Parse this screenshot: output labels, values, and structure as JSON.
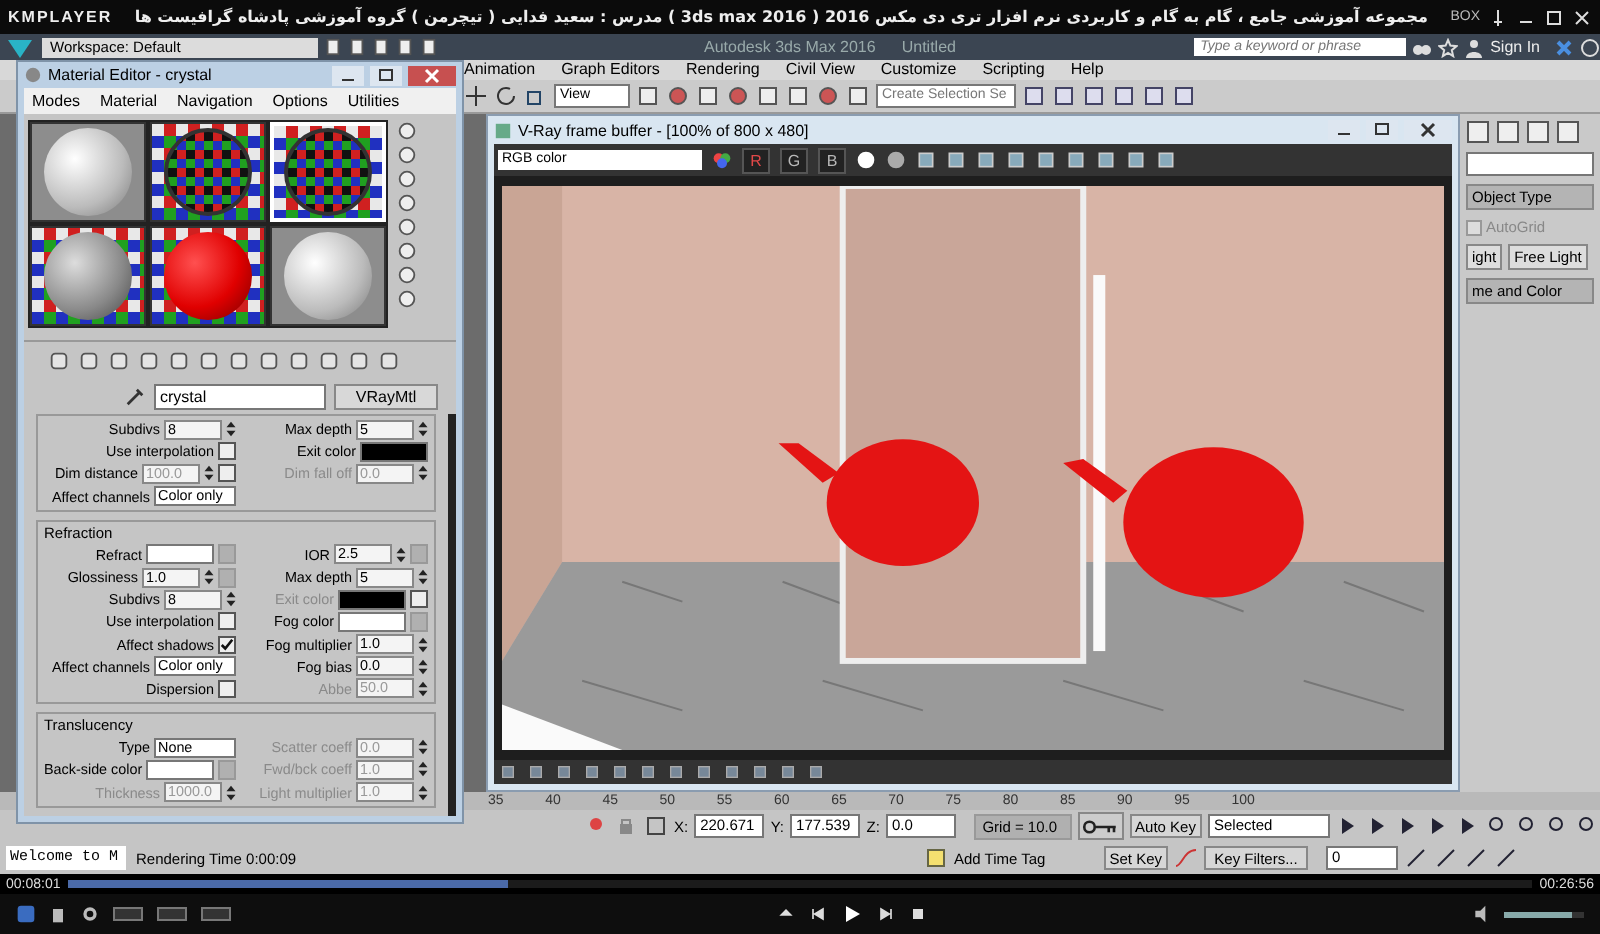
{
  "player": {
    "brand": "KMPLAYER",
    "title": "مجموعه آموزشی جامع ، گام به گام و کاربردی نرم افزار تری دی مکس 2016 ( 3ds max 2016 ) مدرس : سعید فدایی ( تیچرمن ) گروه آموزشی پادشاه گرافیست ها",
    "box": "BOX",
    "elapsed": "00:08:01",
    "total": "00:26:56",
    "progress": {
      "level": 0.3
    },
    "volume": {
      "level": 0.85
    }
  },
  "max": {
    "workspace": "Workspace: Default",
    "title": "Autodesk 3ds Max 2016",
    "file": "Untitled",
    "search": {
      "placeholder": "Type a keyword or phrase"
    },
    "sign_in": "Sign In",
    "menu": [
      "Animation",
      "Graph Editors",
      "Rendering",
      "Civil View",
      "Customize",
      "Scripting",
      "Help"
    ],
    "view": "View",
    "selection_set": "Create Selection Se",
    "command_panel": {
      "object_type": "Object Type",
      "autogrid": {
        "label": "AutoGrid",
        "checked": false,
        "disabled": true
      },
      "buttons": [
        "ight",
        "Free Light"
      ],
      "name_and_color": "me and Color"
    },
    "ruler": [
      "35",
      "40",
      "45",
      "50",
      "55",
      "60",
      "65",
      "70",
      "75",
      "80",
      "85",
      "90",
      "95",
      "100"
    ],
    "status": {
      "prompt": "Welcome to M",
      "render_time": "Rendering Time  0:00:09",
      "coords": [
        {
          "axis": "X:",
          "value": "220.671"
        },
        {
          "axis": "Y:",
          "value": "177.539"
        },
        {
          "axis": "Z:",
          "value": "0.0"
        }
      ],
      "grid": "Grid = 10.0",
      "add_time_tag": "Add Time Tag",
      "auto_key": "Auto Key",
      "key_mode": "Selected",
      "set_key": "Set Key",
      "key_filters": "Key Filters...",
      "frame": "0"
    }
  },
  "material_editor": {
    "title": "Material Editor - crystal",
    "menu": [
      "Modes",
      "Material",
      "Navigation",
      "Options",
      "Utilities"
    ],
    "slots": [
      {
        "kind": "plain",
        "selected": false
      },
      {
        "kind": "checker-ring",
        "selected": false
      },
      {
        "kind": "checker-ring",
        "selected": true
      },
      {
        "kind": "checker-gray",
        "selected": false
      },
      {
        "kind": "red",
        "selected": false
      },
      {
        "kind": "plain",
        "selected": false
      }
    ],
    "material_name": "crystal",
    "material_type": "VRayMtl",
    "sections": [
      {
        "rows": [
          {
            "left": {
              "label": "Subdivs",
              "kind": "spinner",
              "value": "8",
              "disabled": false
            },
            "right": {
              "label": "Max depth",
              "kind": "spinner",
              "value": "5",
              "disabled": false
            }
          },
          {
            "left": {
              "label": "Use interpolation",
              "kind": "checkbox",
              "checked": false,
              "disabled": false
            },
            "right": {
              "label": "Exit color",
              "kind": "color",
              "color": "#000000",
              "disabled": false
            }
          },
          {
            "left": {
              "label": "Dim distance",
              "kind": "spinner-check",
              "value": "100.0",
              "checked": false,
              "disabled": false
            },
            "right": {
              "label": "Dim fall off",
              "kind": "spinner",
              "value": "0.0",
              "disabled": true
            }
          },
          {
            "left": {
              "label": "Affect channels",
              "kind": "dropdown",
              "value": "Color only",
              "disabled": false
            }
          }
        ]
      },
      {
        "title": "Refraction",
        "rows": [
          {
            "left": {
              "label": "Refract",
              "kind": "color",
              "color": "#ffffff",
              "map": true,
              "disabled": false
            },
            "right": {
              "label": "IOR",
              "kind": "spinner",
              "value": "2.5",
              "map": true,
              "disabled": false
            }
          },
          {
            "left": {
              "label": "Glossiness",
              "kind": "spinner",
              "value": "1.0",
              "map": true,
              "disabled": false
            },
            "right": {
              "label": "Max depth",
              "kind": "spinner",
              "value": "5",
              "disabled": false
            }
          },
          {
            "left": {
              "label": "Subdivs",
              "kind": "spinner",
              "value": "8",
              "disabled": false
            },
            "right": {
              "label": "Exit color",
              "kind": "color-check",
              "color": "#000000",
              "checked": false,
              "disabled": true
            }
          },
          {
            "left": {
              "label": "Use interpolation",
              "kind": "checkbox",
              "checked": false,
              "disabled": false
            },
            "right": {
              "label": "Fog color",
              "kind": "color",
              "color": "#ffffff",
              "map": true,
              "disabled": false
            }
          },
          {
            "left": {
              "label": "Affect shadows",
              "kind": "checkbox",
              "checked": true,
              "disabled": false
            },
            "right": {
              "label": "Fog multiplier",
              "kind": "spinner",
              "value": "1.0",
              "disabled": false
            }
          },
          {
            "left": {
              "label": "Affect channels",
              "kind": "dropdown",
              "value": "Color only",
              "disabled": false
            },
            "right": {
              "label": "Fog bias",
              "kind": "spinner",
              "value": "0.0",
              "disabled": false
            }
          },
          {
            "left": {
              "label": "Dispersion",
              "kind": "checkbox",
              "checked": false,
              "disabled": false
            },
            "right": {
              "label": "Abbe",
              "kind": "spinner",
              "value": "50.0",
              "disabled": true
            }
          }
        ]
      },
      {
        "title": "Translucency",
        "rows": [
          {
            "left": {
              "label": "Type",
              "kind": "dropdown",
              "value": "None",
              "disabled": false
            },
            "right": {
              "label": "Scatter coeff",
              "kind": "spinner",
              "value": "0.0",
              "disabled": true
            }
          },
          {
            "left": {
              "label": "Back-side color",
              "kind": "color",
              "color": "#ffffff",
              "map": true,
              "disabled": false
            },
            "right": {
              "label": "Fwd/bck coeff",
              "kind": "spinner",
              "value": "1.0",
              "disabled": true
            }
          },
          {
            "left": {
              "label": "Thickness",
              "kind": "spinner",
              "value": "1000.0",
              "disabled": true
            },
            "right": {
              "label": "Light multiplier",
              "kind": "spinner",
              "value": "1.0",
              "disabled": true
            }
          }
        ]
      }
    ]
  },
  "frame_buffer": {
    "title": "V-Ray frame buffer - [100% of 800 x 480]",
    "channel": "RGB color",
    "channel_buttons": [
      {
        "label": "R",
        "color": "#e04848"
      },
      {
        "label": "G",
        "color": "#b8b8b8"
      },
      {
        "label": "B",
        "color": "#b8b8b8"
      }
    ]
  }
}
